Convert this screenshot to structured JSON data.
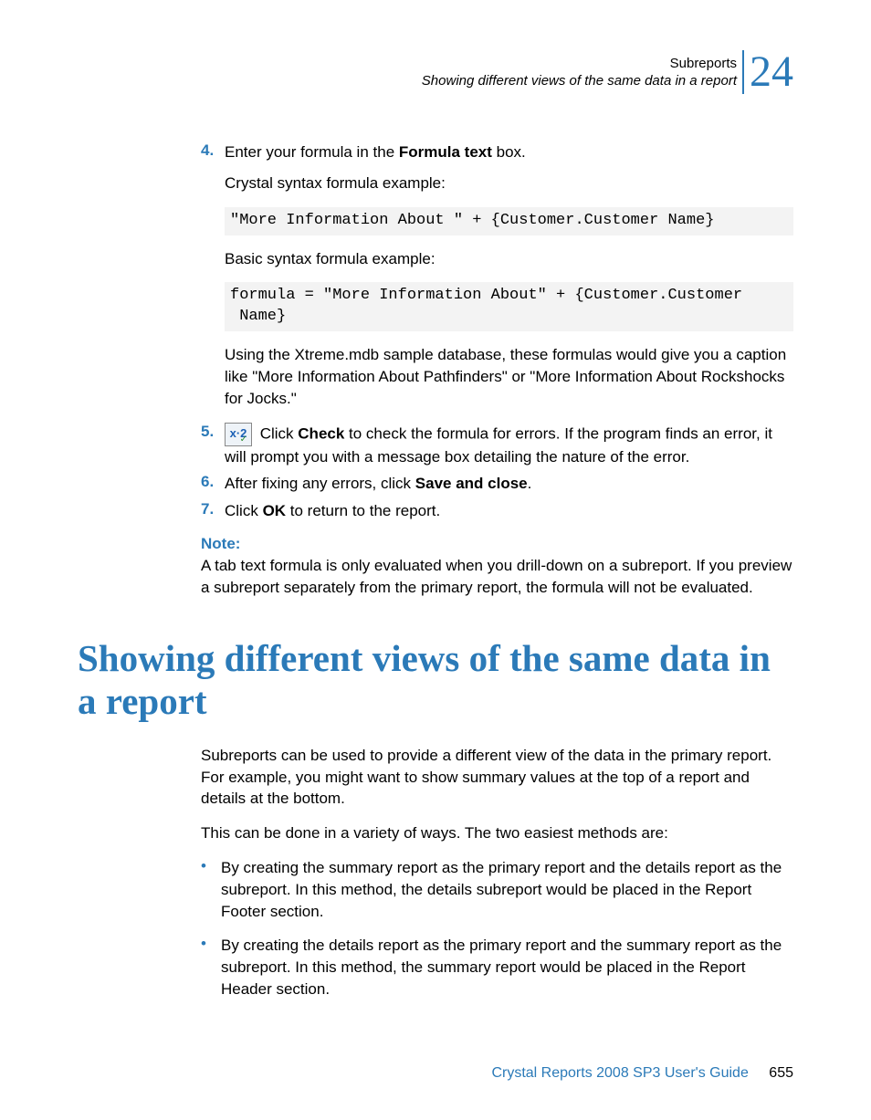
{
  "header": {
    "chapter": "Subreports",
    "section": "Showing different views of the same data in a report",
    "chapter_number": "24"
  },
  "steps": {
    "s4": {
      "num": "4.",
      "text_a": "Enter your formula in the ",
      "bold": "Formula text",
      "text_b": " box."
    },
    "p_crystal": "Crystal syntax formula example:",
    "code_crystal": "\"More Information About \" + {Customer.Customer Name}",
    "p_basic": "Basic syntax formula example:",
    "code_basic": "formula = \"More Information About\" + {Customer.Customer\n Name}",
    "p_using": "Using the Xtreme.mdb sample database, these formulas would give you a caption like \"More Information About Pathfinders\" or \"More Information About Rockshocks for Jocks.\"",
    "s5": {
      "num": "5.",
      "text_a": " Click ",
      "bold": "Check",
      "text_b": " to check the formula for errors. If the program finds an error, it will prompt you with a message box detailing the nature of the error."
    },
    "s6": {
      "num": "6.",
      "text_a": "After fixing any errors, click ",
      "bold": "Save and close",
      "text_b": "."
    },
    "s7": {
      "num": "7.",
      "text_a": "Click ",
      "bold": "OK",
      "text_b": " to return to the report."
    }
  },
  "note": {
    "label": "Note:",
    "body": "A tab text formula is only evaluated when you drill-down on a subreport. If you preview a subreport separately from the primary report, the formula will not be evaluated."
  },
  "heading": "Showing different views of the same data in a report",
  "body": {
    "p1": "Subreports can be used to provide a different view of the data in the primary report. For example, you might want to show summary values at the top of a report and details at the bottom.",
    "p2": "This can be done in a variety of ways. The two easiest methods are:",
    "bullets": [
      "By creating the summary report as the primary report and the details report as the subreport. In this method, the details subreport would be placed in the Report Footer section.",
      "By creating the details report as the primary report and the summary report as the subreport. In this method, the summary report would be placed in the Report Header section."
    ]
  },
  "footer": {
    "title": "Crystal Reports 2008 SP3 User's Guide",
    "page": "655"
  },
  "icon": {
    "x2": "x·2",
    "check": "✓"
  }
}
